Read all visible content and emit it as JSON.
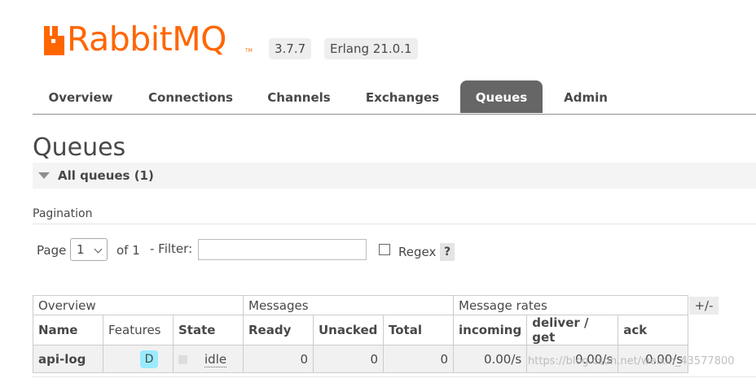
{
  "header": {
    "brand": "RabbitMQ",
    "version": "3.7.7",
    "erlang": "Erlang 21.0.1",
    "brand_color": "#ff6600"
  },
  "nav": {
    "items": [
      {
        "label": "Overview",
        "active": false
      },
      {
        "label": "Connections",
        "active": false
      },
      {
        "label": "Channels",
        "active": false
      },
      {
        "label": "Exchanges",
        "active": false
      },
      {
        "label": "Queues",
        "active": true
      },
      {
        "label": "Admin",
        "active": false
      }
    ]
  },
  "page": {
    "title": "Queues",
    "section_label": "All queues (1)"
  },
  "pagination": {
    "label": "Pagination",
    "page_label": "Page",
    "page_value": "1",
    "of_label": "of 1",
    "filter_label": "- Filter:",
    "filter_value": "",
    "regex_label": "Regex",
    "help_label": "?"
  },
  "table": {
    "groups": [
      "Overview",
      "Messages",
      "Message rates"
    ],
    "columns": [
      "Name",
      "Features",
      "State",
      "Ready",
      "Unacked",
      "Total",
      "incoming",
      "deliver / get",
      "ack"
    ],
    "toggle_label": "+/-",
    "rows": [
      {
        "name": "api-log",
        "feature": "D",
        "state": "idle",
        "ready": "0",
        "unacked": "0",
        "total": "0",
        "incoming": "0.00/s",
        "deliver_get": "0.00/s",
        "ack": "0.00/s"
      }
    ]
  },
  "watermark": "https://blog.csdn.net/weixin_43577800",
  "icons": [
    "rabbit-logo-icon",
    "collapse-triangle-icon",
    "chevron-down-icon"
  ]
}
